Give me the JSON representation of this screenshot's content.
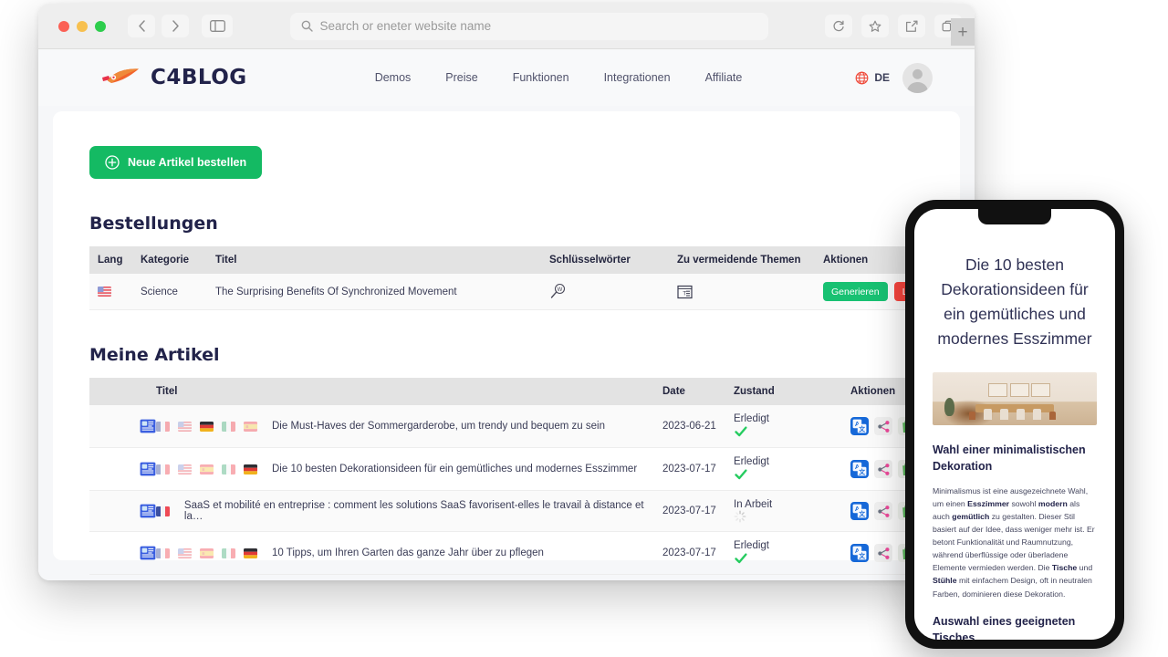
{
  "browser": {
    "back_icon": "chevron-left-icon",
    "forward_icon": "chevron-right-icon",
    "sidebar_icon": "sidebar-toggle-icon",
    "search_placeholder": "Search or eneter website name",
    "reload_icon": "reload-icon",
    "bookmark_icon": "star-icon",
    "share_icon": "share-icon",
    "tabs_icon": "tabs-icon",
    "new_tab_label": "+"
  },
  "site": {
    "logo_text": "C4BLOG",
    "nav": [
      {
        "label": "Demos"
      },
      {
        "label": "Preise"
      },
      {
        "label": "Funktionen"
      },
      {
        "label": "Integrationen"
      },
      {
        "label": "Affiliate"
      }
    ],
    "language": "DE",
    "globe_icon": "globe-icon",
    "avatar_icon": "user-avatar-icon"
  },
  "dashboard": {
    "order_button": "Neue Artikel bestellen",
    "order_button_icon": "plus-circle-icon",
    "orders_heading": "Bestellungen",
    "orders_table": {
      "columns": [
        "Lang",
        "Kategorie",
        "Titel",
        "Schlüsselwörter",
        "Zu vermeidende Themen",
        "Aktionen"
      ],
      "rows": [
        {
          "lang_flag": "us",
          "kategorie": "Science",
          "titel": "The Surprising Benefits Of Synchronized Movement",
          "keywords_icon": "magnifier-w-icon",
          "avoid_icon": "article-text-icon",
          "generate_label": "Generieren",
          "delete_label": "Lösch"
        }
      ]
    },
    "articles_heading": "Meine Artikel",
    "articles_table": {
      "columns": [
        "",
        "Titel",
        "Date",
        "Zustand",
        "Aktionen"
      ],
      "rows": [
        {
          "doc_icon": "article-doc-icon",
          "flags": [
            "fr",
            "us",
            "de",
            "it",
            "es"
          ],
          "active_flag": "de",
          "titel": "Die Must-Haves der Sommergarderobe, um trendy und bequem zu sein",
          "date": "2023-06-21",
          "zustand": "Erledigt",
          "status_icon": "check-icon",
          "actions": [
            "translate-icon",
            "share-icon",
            "shopify-bag-icon"
          ]
        },
        {
          "doc_icon": "article-doc-icon",
          "flags": [
            "fr",
            "us",
            "es",
            "it",
            "de"
          ],
          "active_flag": "de",
          "titel": "Die 10 besten Dekorationsideen für ein gemütliches und modernes Esszimmer",
          "date": "2023-07-17",
          "zustand": "Erledigt",
          "status_icon": "check-icon",
          "actions": [
            "translate-icon",
            "share-icon",
            "shopify-bag-icon"
          ]
        },
        {
          "doc_icon": "article-doc-icon",
          "flags": [
            "fr"
          ],
          "active_flag": "fr",
          "titel": "SaaS et mobilité en entreprise : comment les solutions SaaS favorisent-elles le travail à distance et la…",
          "date": "2023-07-17",
          "zustand": "In Arbeit",
          "status_icon": "spinner-icon",
          "actions": [
            "translate-icon",
            "share-icon",
            "shopify-bag-icon"
          ]
        },
        {
          "doc_icon": "article-doc-icon",
          "flags": [
            "fr",
            "us",
            "es",
            "it",
            "de"
          ],
          "active_flag": "de",
          "titel": "10 Tipps, um Ihren Garten das ganze Jahr über zu pflegen",
          "date": "2023-07-17",
          "zustand": "Erledigt",
          "status_icon": "check-icon",
          "actions": [
            "translate-icon",
            "share-icon",
            "shopify-bag-icon"
          ]
        }
      ]
    }
  },
  "phone": {
    "title": "Die 10 besten Dekorationsideen für ein gemütliches und modernes Esszimmer",
    "hero_alt": "dining-room-photo",
    "section1_heading": "Wahl einer minimalistischen Dekoration",
    "section1_body_1": "Minimalismus ist eine ausgezeichnete Wahl, um einen ",
    "section1_bold_1": "Esszimmer",
    "section1_body_2": " sowohl ",
    "section1_bold_2": "modern",
    "section1_body_3": " als auch ",
    "section1_bold_3": "gemütlich",
    "section1_body_4": " zu gestalten. Dieser Stil basiert auf der Idee, dass weniger mehr ist. Er betont Funktionalität und Raumnutzung, während überflüssige oder überladene Elemente vermieden werden. Die ",
    "section1_bold_4": "Tische",
    "section1_body_5": " und ",
    "section1_bold_5": "Stühle",
    "section1_body_6": " mit einfachem Design, oft in neutralen Farben, dominieren diese Dekoration.",
    "section2_heading": "Auswahl eines geeigneten Tisches"
  },
  "colors": {
    "brand_dark": "#22234a",
    "green": "#14ba63",
    "red": "#f9453e",
    "blue": "#1668d8"
  }
}
